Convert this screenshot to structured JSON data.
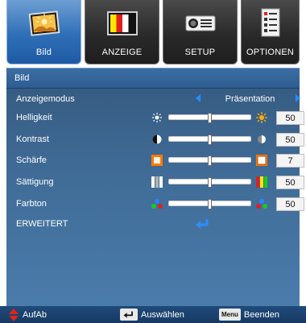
{
  "tabs": [
    {
      "label": "Bild",
      "icon": "picture-icon",
      "active": true
    },
    {
      "label": "ANZEIGE",
      "icon": "color-bars-icon",
      "active": false
    },
    {
      "label": "SETUP",
      "icon": "projector-icon",
      "active": false
    },
    {
      "label": "OPTIONEN",
      "icon": "checklist-icon",
      "active": false
    }
  ],
  "panel": {
    "title": "Bild",
    "mode": {
      "label": "Anzeigemodus",
      "value": "Präsentation"
    },
    "sliders": [
      {
        "label": "Helligkeit",
        "value": "50",
        "left_icon": "sun-dim-icon",
        "right_icon": "sun-bright-icon",
        "level": 0.5
      },
      {
        "label": "Kontrast",
        "value": "50",
        "left_icon": "contrast-low-icon",
        "right_icon": "contrast-high-icon",
        "level": 0.5
      },
      {
        "label": "Schärfe",
        "value": "7",
        "left_icon": "sharpness-low-icon",
        "right_icon": "sharpness-high-icon",
        "level": 0.5
      },
      {
        "label": "Sättigung",
        "value": "50",
        "left_icon": "saturation-low-icon",
        "right_icon": "saturation-high-icon",
        "level": 0.5
      },
      {
        "label": "Farbton",
        "value": "50",
        "left_icon": "tint-low-icon",
        "right_icon": "tint-high-icon",
        "level": 0.5
      }
    ],
    "advanced": {
      "label": "ERWEITERT",
      "icon": "enter-icon"
    }
  },
  "footer": {
    "updown": {
      "icon": "up-down-arrow-icon",
      "label": "AufAb"
    },
    "select": {
      "icon": "enter-key-icon",
      "label": "Auswählen"
    },
    "back": {
      "key": "Menu",
      "label": "Beenden"
    }
  },
  "colors": {
    "accent": "#1e90ff",
    "tab_active": "#2f6fb7",
    "panel": "#3f6a95",
    "footer": "#1f4a7a"
  }
}
